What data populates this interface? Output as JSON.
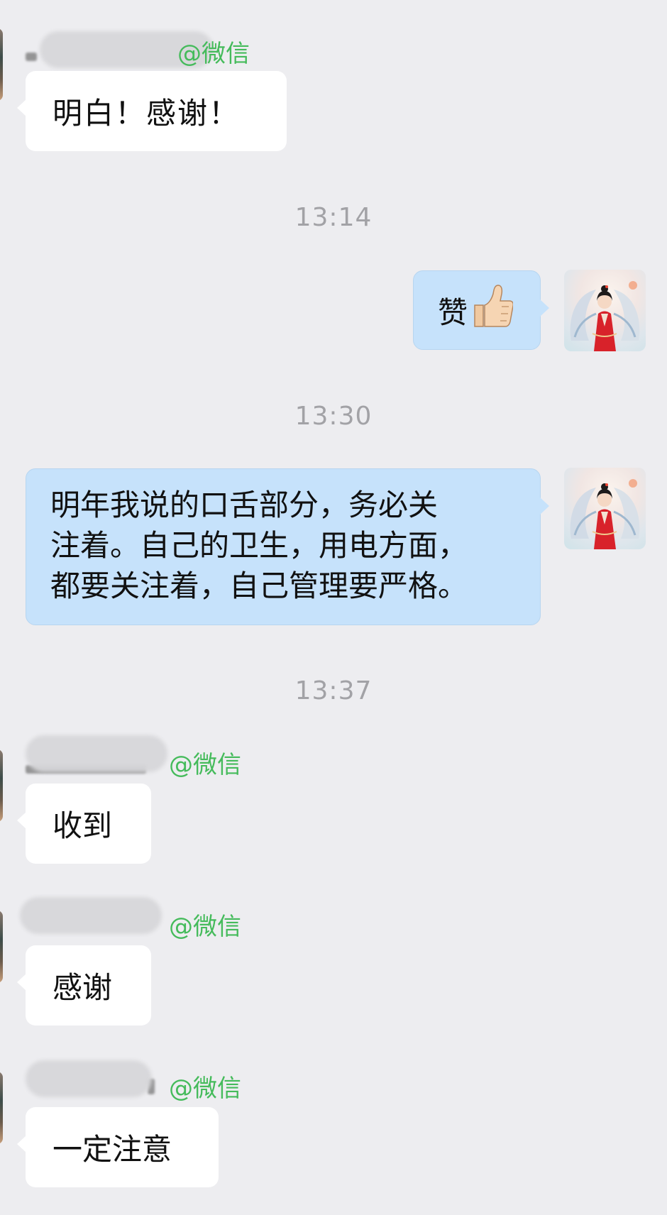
{
  "messages": [
    {
      "type": "incoming",
      "sender_suffix": "@微信",
      "text": "明白！感谢！"
    },
    {
      "type": "time",
      "text": "13:14"
    },
    {
      "type": "outgoing",
      "text": "赞",
      "emoji": "👍"
    },
    {
      "type": "time",
      "text": "13:30"
    },
    {
      "type": "outgoing",
      "lines": [
        "明年我说的口舌部分，务必关",
        "注着。自己的卫生，用电方面，",
        "都要关注着，自己管理要严格。"
      ]
    },
    {
      "type": "time",
      "text": "13:37"
    },
    {
      "type": "incoming",
      "sender_suffix": "@微信",
      "text": "收到"
    },
    {
      "type": "incoming",
      "sender_suffix": "@微信",
      "text": "感谢"
    },
    {
      "type": "incoming",
      "sender_suffix": "@微信",
      "text": "一定注意"
    }
  ],
  "icons": {
    "thumbs_up": "thumbs-up-icon",
    "self_avatar": "avatar (woman in red hanfu with white wings)"
  },
  "colors": {
    "background": "#ededf0",
    "incoming_bubble": "#ffffff",
    "outgoing_bubble": "#c6e2fb",
    "wechat_tag": "#45bb5b",
    "timestamp": "#a2a2a6"
  }
}
